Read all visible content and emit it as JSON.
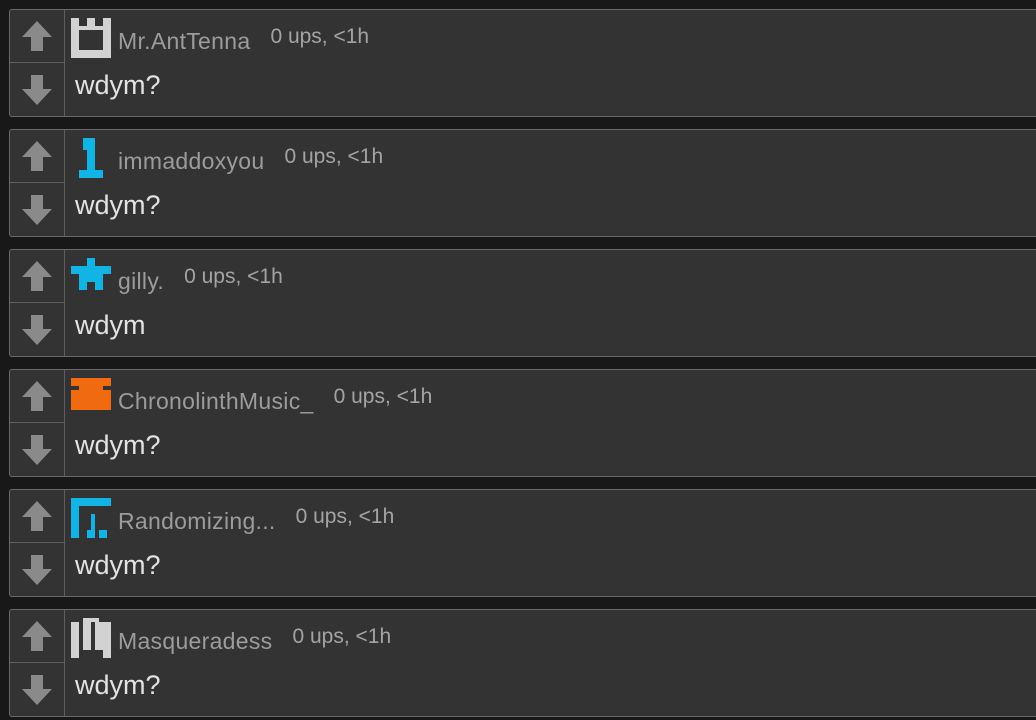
{
  "colors": {
    "background": "#181818",
    "card": "#333333",
    "card_border": "#6a6a6a",
    "arrow": "#8a8a8a",
    "username": "#9c9c9c",
    "meta": "#a4a4a4",
    "message": "#e3e3e3",
    "avatar_cyan": "#12b4e6",
    "avatar_orange": "#f06a10",
    "avatar_gray": "#d2d2d2"
  },
  "comments": [
    {
      "username": "Mr.AntTenna",
      "meta": "0 ups, <1h",
      "message": "wdym?",
      "avatar_icon": "castle-icon",
      "avatar_color": "#d2d2d2"
    },
    {
      "username": "immaddoxyou",
      "meta": "0 ups, <1h",
      "message": "wdym?",
      "avatar_icon": "figure-one-icon",
      "avatar_color": "#12b4e6"
    },
    {
      "username": "gilly.",
      "meta": "0 ups, <1h",
      "message": "wdym",
      "avatar_icon": "star-icon",
      "avatar_color": "#12b4e6"
    },
    {
      "username": "ChronolinthMusic_",
      "meta": "0 ups, <1h",
      "message": "wdym?",
      "avatar_icon": "block-icon",
      "avatar_color": "#f06a10"
    },
    {
      "username": "Randomizing...",
      "meta": "0 ups, <1h",
      "message": "wdym?",
      "avatar_icon": "frame-icon",
      "avatar_color": "#12b4e6"
    },
    {
      "username": "Masqueradess",
      "meta": "0 ups, <1h",
      "message": "wdym?",
      "avatar_icon": "pillars-icon",
      "avatar_color": "#d2d2d2"
    }
  ]
}
